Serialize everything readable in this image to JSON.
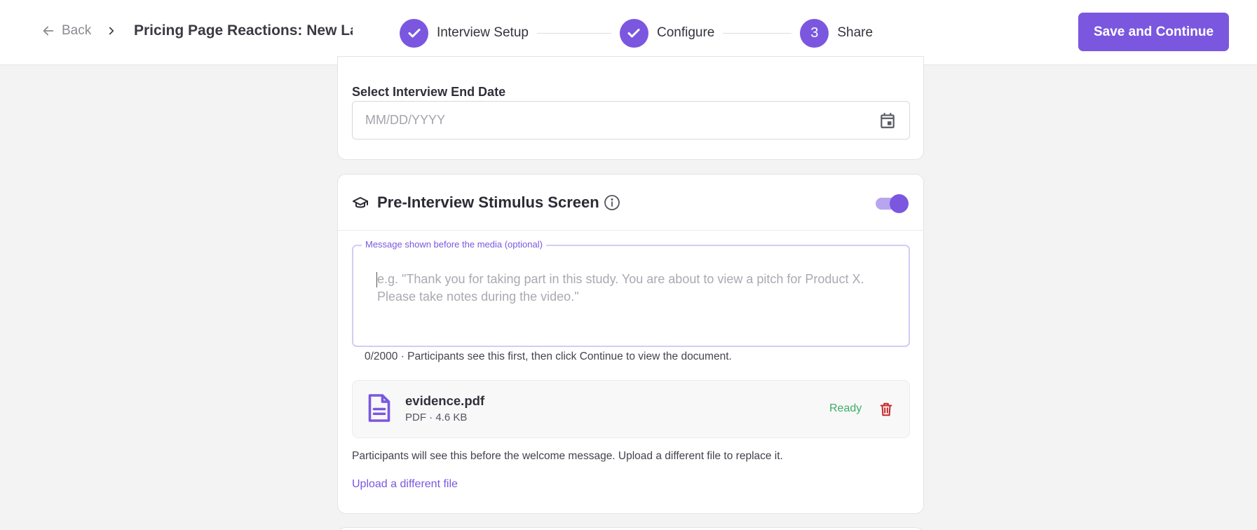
{
  "header": {
    "back_label": "Back",
    "project_title": "Pricing Page Reactions: New La",
    "save_label": "Save and Continue"
  },
  "stepper": {
    "steps": [
      {
        "label": "Interview Setup",
        "state": "complete"
      },
      {
        "label": "Configure",
        "state": "complete"
      },
      {
        "label": "Share",
        "state": "current",
        "number": "3"
      }
    ]
  },
  "end_date": {
    "label": "Select Interview End Date",
    "placeholder": "MM/DD/YYYY"
  },
  "stimulus": {
    "title": "Pre-Interview Stimulus Screen",
    "enabled": true,
    "message_label": "Message shown before the media (optional)",
    "message_placeholder": "e.g. \"Thank you for taking part in this study. You are about to view a pitch for Product X. Please take notes during the video.\"",
    "counter_text": "0/2000 · Participants see this first, then click Continue to view the document.",
    "file": {
      "name": "evidence.pdf",
      "meta": "PDF · 4.6 KB",
      "status": "Ready"
    },
    "help_text": "Participants will see this before the welcome message. Upload a different file to replace it.",
    "upload_link": "Upload a different file"
  },
  "colors": {
    "accent": "#7b57e0",
    "success": "#3dae64",
    "danger": "#c62828"
  }
}
